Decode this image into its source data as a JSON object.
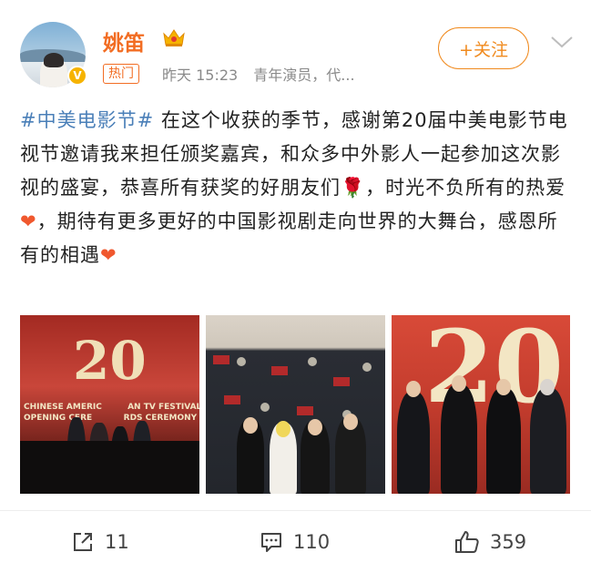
{
  "user": {
    "name": "姚笛",
    "hot_badge": "热门",
    "time": "昨天 15:23",
    "description": "青年演员，代..."
  },
  "follow_label": "+关注",
  "post": {
    "hashtag": "#中美电影节#",
    "text_part1": " 在这个收获的季节，感谢第20届中美电影节电视节邀请我来担任颁奖嘉宾，和众多中外影人一起参加这次影视的盛宴，恭喜所有获奖的好朋友们",
    "emoji1": "🌹",
    "text_part2": "，时光不负所有的热爱",
    "emoji2": "❤",
    "text_part3": "，期待有更多更好的中国影视剧走向世界的大舞台，感恩所有的相遇",
    "emoji3": "❤"
  },
  "photos": {
    "banner_number": "20",
    "banner_line1": "CHINESE AMERIC",
    "banner_line1b": "AN TV FESTIVAL",
    "banner_line2": "OPENING CERE",
    "banner_line2b": "RDS CEREMONY"
  },
  "actions": {
    "repost_count": "11",
    "comment_count": "110",
    "like_count": "359"
  },
  "colors": {
    "accent": "#f26d23",
    "follow": "#f08a1e",
    "hashtag": "#4a7fb8",
    "verified": "#f6b300"
  }
}
